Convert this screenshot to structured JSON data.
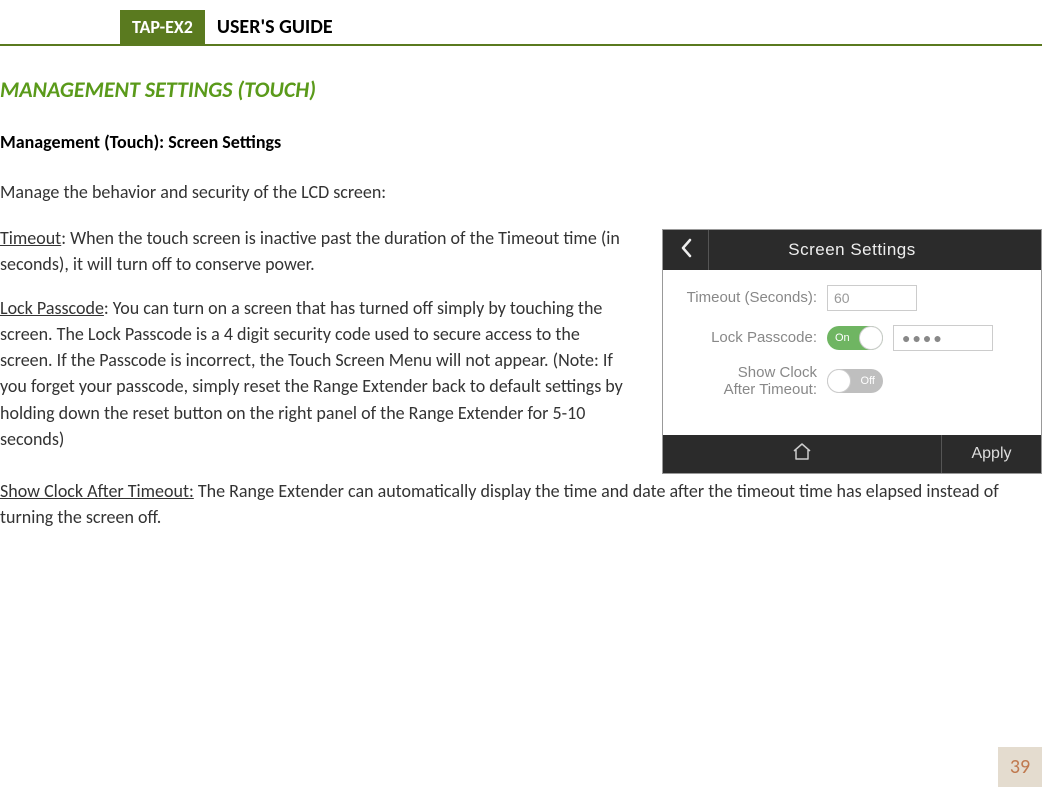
{
  "header": {
    "tag": "TAP-EX2",
    "title": "USER'S GUIDE"
  },
  "section_heading": "MANAGEMENT SETTINGS (TOUCH)",
  "sub_heading": "Management (Touch): Screen Settings",
  "intro": "Manage the behavior and security of the LCD screen:",
  "paragraphs": {
    "timeout_label": "Timeout",
    "timeout_body": ":  When the touch screen is inactive past the duration of the Timeout time (in seconds), it will turn off to conserve power.",
    "lock_label": "Lock Passcode",
    "lock_body": ": You can turn on a screen that has turned off simply by touching the screen.  The Lock Passcode is a 4 digit security code used to secure access to the screen.  If the Passcode is incorrect, the Touch Screen Menu will not appear. (Note: If you forget your passcode, simply reset the Range Extender back to default settings by holding down the reset button on the right panel of the Range Extender for 5-10 seconds)",
    "clock_label": "Show Clock After Timeout:",
    "clock_body": " The Range Extender can automatically display the time and date after the timeout time has elapsed instead of turning the screen off."
  },
  "screenshot": {
    "title": "Screen Settings",
    "timeout_label": "Timeout (Seconds):",
    "timeout_value": "60",
    "lock_label": "Lock Passcode:",
    "lock_toggle": "On",
    "lock_value": "●●●●",
    "clock_label_line1": "Show Clock",
    "clock_label_line2": "After Timeout:",
    "clock_toggle": "Off",
    "apply": "Apply"
  },
  "page_number": "39"
}
